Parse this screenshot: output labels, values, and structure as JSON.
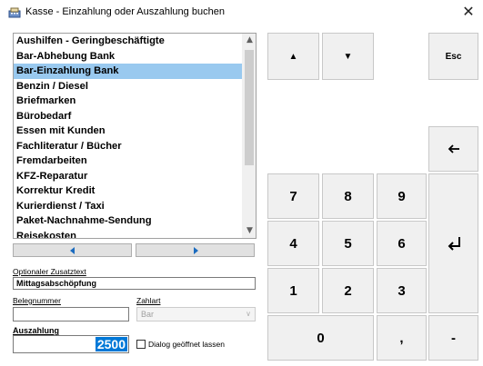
{
  "window": {
    "title": "Kasse - Einzahlung oder Auszahlung buchen",
    "close_glyph": "✕",
    "icon": "cash-register-icon"
  },
  "list": {
    "items": [
      "Aushilfen - Geringbeschäftigte",
      "Bar-Abhebung Bank",
      "Bar-Einzahlung Bank",
      "Benzin / Diesel",
      "Briefmarken",
      "Bürobedarf",
      "Essen mit Kunden",
      "Fachliteratur / Bücher",
      "Fremdarbeiten",
      "KFZ-Reparatur",
      "Korrektur Kredit",
      "Kurierdienst / Taxi",
      "Paket-Nachnahme-Sendung",
      "Reisekosten"
    ],
    "selected_index": 2,
    "scroll_up_glyph": "▲",
    "scroll_down_glyph": "▼"
  },
  "form": {
    "zusatztext_label": "Optionaler Zusatztext",
    "zusatztext_value": "Mittagsabschöpfung",
    "belegnummer_label": "Belegnummer",
    "belegnummer_value": "",
    "zahlart_label": "Zahlart",
    "zahlart_value": "Bar",
    "select_chevron": "∨",
    "auszahlung_label": "Auszahlung",
    "amount_value": "2500",
    "dialog_open_label": "Dialog geöffnet lassen",
    "dialog_open_checked": false
  },
  "keypad": {
    "up_label": "▲",
    "down_label": "▼",
    "esc_label": "Esc",
    "k7": "7",
    "k8": "8",
    "k9": "9",
    "k4": "4",
    "k5": "5",
    "k6": "6",
    "k1": "1",
    "k2": "2",
    "k3": "3",
    "k0": "0",
    "comma": ",",
    "minus": "-",
    "backspace_icon": "arrow-left-icon",
    "enter_icon": "enter-return-icon"
  },
  "colors": {
    "selection": "#99c9ef",
    "accent": "#0078d7",
    "nav_arrow": "#1a6bbf",
    "key_bg": "#f0f0f0"
  }
}
